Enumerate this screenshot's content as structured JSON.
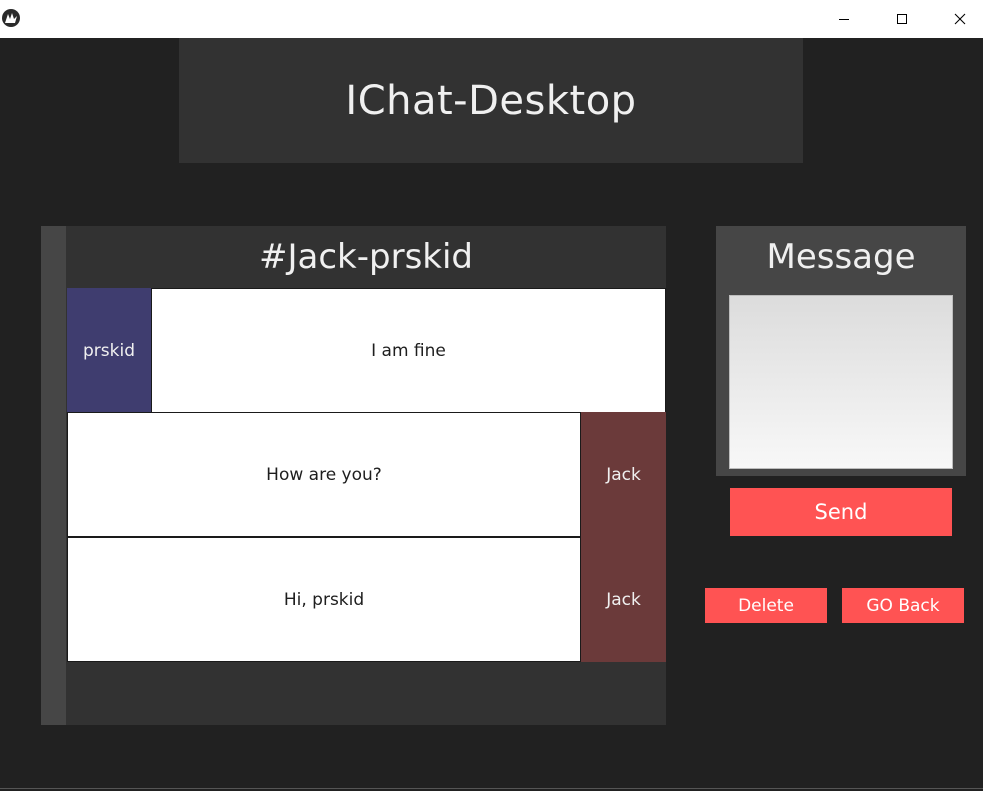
{
  "window": {
    "icons": {
      "app": "kivy-logo-icon",
      "minimize": "minimize-icon",
      "maximize": "maximize-icon",
      "close": "close-icon"
    }
  },
  "header": {
    "title": "IChat-Desktop"
  },
  "chat": {
    "title": "#Jack-prskid",
    "messages": [
      {
        "sender": "prskid",
        "text": "I am fine",
        "side": "left"
      },
      {
        "sender": "Jack",
        "text": "How are you?",
        "side": "right"
      },
      {
        "sender": "Jack",
        "text": "Hi, prskid",
        "side": "right"
      }
    ]
  },
  "compose": {
    "label": "Message",
    "value": "",
    "send_label": "Send"
  },
  "actions": {
    "delete_label": "Delete",
    "goback_label": "GO Back"
  },
  "colors": {
    "background": "#212121",
    "panel": "#323232",
    "accent": "#ff5353",
    "self_sender": "#3f3d6f",
    "other_sender": "#6b3a3a"
  }
}
